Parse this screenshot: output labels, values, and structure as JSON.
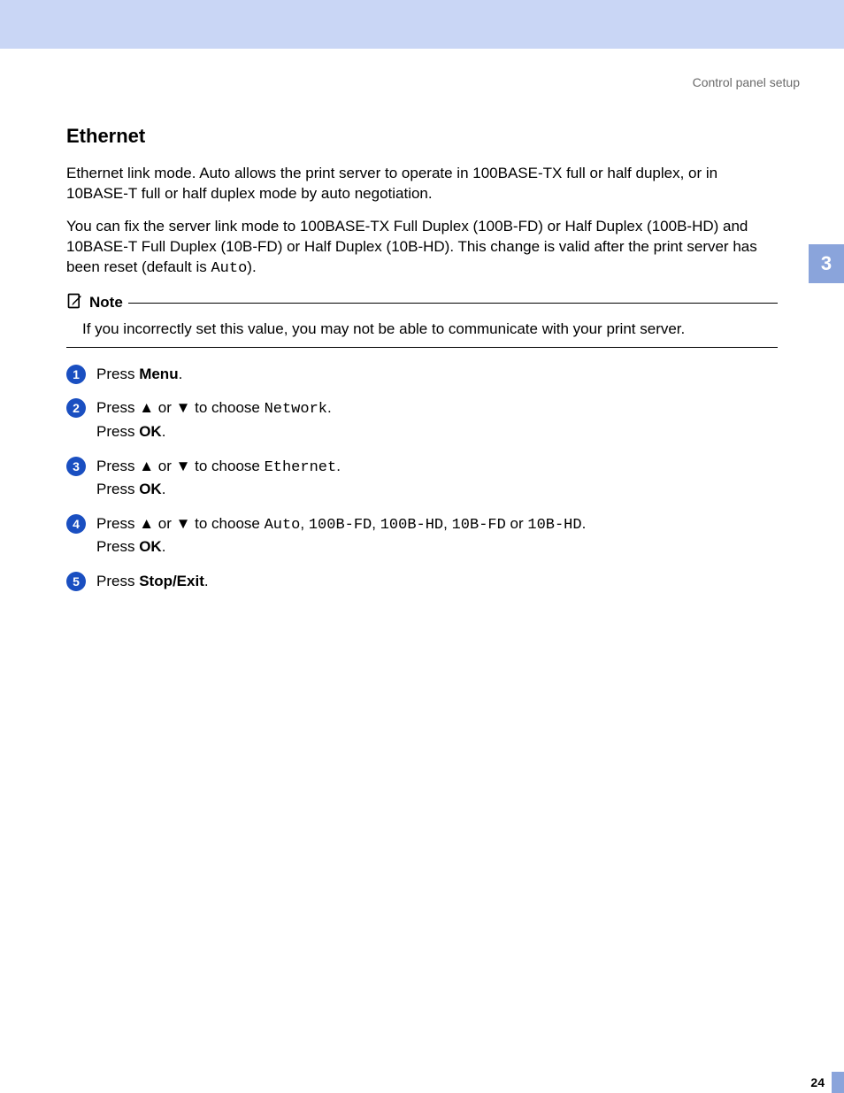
{
  "header": {
    "breadcrumb": "Control panel setup"
  },
  "chapter_tab": "3",
  "title": "Ethernet",
  "intro_paragraphs": {
    "p1": "Ethernet link mode. Auto allows the print server to operate in 100BASE-TX full or half duplex, or in 10BASE-T full or half duplex mode by auto negotiation.",
    "p2_pre": "You can fix the server link mode to 100BASE-TX Full Duplex (100B-FD) or Half Duplex (100B-HD) and 10BASE-T Full Duplex (10B-FD) or Half Duplex (10B-HD). This change is valid after the print server has been reset (default is ",
    "p2_code": "Auto",
    "p2_post": ")."
  },
  "note": {
    "label": "Note",
    "body": "If you incorrectly set this value, you may not be able to communicate with your print server."
  },
  "arrows": {
    "up": "▲",
    "down": "▼"
  },
  "steps": {
    "s1": {
      "num": "1",
      "press": "Press ",
      "menu": "Menu",
      "end": "."
    },
    "s2": {
      "num": "2",
      "l1_pre": "Press ",
      "l1_mid": " or ",
      "l1_choose": " to choose ",
      "l1_code": "Network",
      "l1_end": ".",
      "l2_pre": "Press ",
      "l2_ok": "OK",
      "l2_end": "."
    },
    "s3": {
      "num": "3",
      "l1_pre": "Press ",
      "l1_mid": " or ",
      "l1_choose": " to choose ",
      "l1_code": "Ethernet",
      "l1_end": ".",
      "l2_pre": "Press ",
      "l2_ok": "OK",
      "l2_end": "."
    },
    "s4": {
      "num": "4",
      "l1_pre": "Press ",
      "l1_mid": " or ",
      "l1_choose": " to choose ",
      "c1": "Auto",
      "sep1": ", ",
      "c2": "100B-FD",
      "sep2": ", ",
      "c3": "100B-HD",
      "sep3": ", ",
      "c4": "10B-FD",
      "sep4": " or ",
      "c5": "10B-HD",
      "l1_end": ".",
      "l2_pre": "Press ",
      "l2_ok": "OK",
      "l2_end": "."
    },
    "s5": {
      "num": "5",
      "press": "Press ",
      "stopexit": "Stop/Exit",
      "end": "."
    }
  },
  "page_number": "24"
}
